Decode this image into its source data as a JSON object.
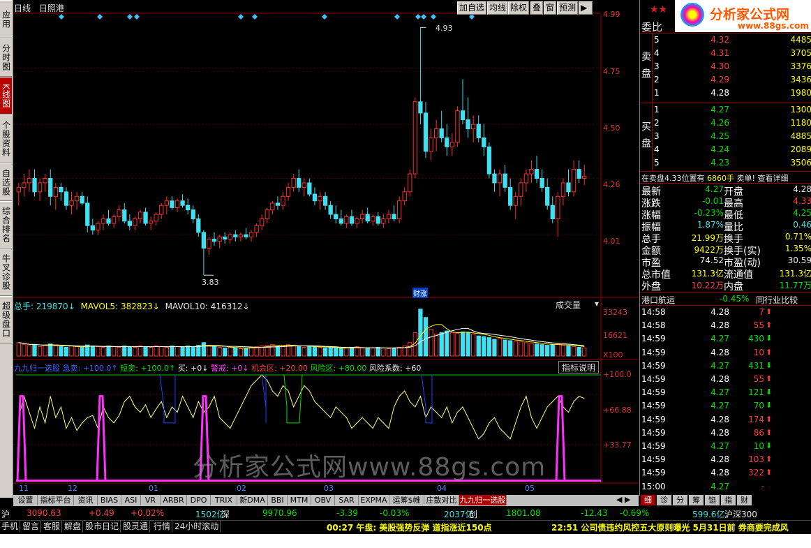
{
  "left_nav": [
    "应用",
    "分时图",
    "K线图",
    "个股资料",
    "自选股",
    "综合排名",
    "牛叉诊股",
    "超级盘口"
  ],
  "header": {
    "period": "日线",
    "stock": "日照港"
  },
  "toolbar": [
    "加自选",
    "均线",
    "除权",
    "叠",
    "窗",
    "预测"
  ],
  "price_axis": [
    "4.99",
    "4.75",
    "4.50",
    "4.26",
    "4.01"
  ],
  "annotations": {
    "high": "4.93",
    "low": "3.83",
    "event": "财涨"
  },
  "volume": {
    "label": "总手: 219870↓",
    "ma5": "MAVOL5: 382823↓",
    "ma10": "MAVOL10: 416312↓",
    "dropdown": "成交量",
    "axis": [
      "33243",
      "16621",
      "X100"
    ]
  },
  "indicator": {
    "legend": [
      "九九归一选股",
      "急卖: +100.0↑",
      "短卖: +100.0↑",
      "买: +0↓",
      "警戒: +0↓",
      "机会区: +20.00",
      "风险区: +80.00",
      "风险系数: +60"
    ],
    "button": "指标说明",
    "axis": [
      "+100.0",
      "+66.88",
      "+33.77"
    ]
  },
  "months": [
    "11",
    "12",
    "01",
    "02",
    "03",
    "04",
    "05"
  ],
  "watermark": "分析家公式网www.88gs.com",
  "tabs": [
    "设置",
    "指标平台",
    "资讯",
    "BIAS",
    "ASI",
    "VR",
    "ARBR",
    "DPO",
    "TRIX",
    "新DMA",
    "BBI",
    "MTM",
    "OBV",
    "SAR",
    "EXPMA",
    "运筹$帷幄",
    "庄散对比",
    "九九归一选股"
  ],
  "logo": {
    "title": "分析家公式网",
    "url": "www.88gs.com"
  },
  "order_book": {
    "header": "委比",
    "sell_label": "卖盘",
    "buy_label": "买盘",
    "sell": [
      {
        "lvl": "5",
        "price": "4.32",
        "vol": "4485"
      },
      {
        "lvl": "4",
        "price": "4.31",
        "vol": "3705"
      },
      {
        "lvl": "3",
        "price": "4.30",
        "vol": "3376"
      },
      {
        "lvl": "2",
        "price": "4.29",
        "vol": "3436"
      },
      {
        "lvl": "1",
        "price": "4.28",
        "vol": "1980"
      }
    ],
    "buy": [
      {
        "lvl": "1",
        "price": "4.27",
        "vol": "1300"
      },
      {
        "lvl": "2",
        "price": "4.26",
        "vol": "1180"
      },
      {
        "lvl": "3",
        "price": "4.25",
        "vol": "4885"
      },
      {
        "lvl": "4",
        "price": "4.24",
        "vol": "2089"
      },
      {
        "lvl": "5",
        "price": "4.23",
        "vol": "3506"
      }
    ],
    "notice_left": "在卖盘4.33位置有",
    "notice_vol": "6860手",
    "notice_right": "卖单! 查看详细"
  },
  "quote": [
    {
      "l": "最新",
      "v": "4.27",
      "c": "green",
      "l2": "开盘",
      "v2": "4.28",
      "c2": "white"
    },
    {
      "l": "涨跌",
      "v": "-0.01",
      "c": "green",
      "l2": "最高",
      "v2": "4.33",
      "c2": "red"
    },
    {
      "l": "涨幅",
      "v": "-0.23%",
      "c": "green",
      "l2": "最低",
      "v2": "4.25",
      "c2": "green"
    },
    {
      "l": "振幅",
      "v": "1.87%",
      "c": "cyan",
      "l2": "量比",
      "v2": "0.46",
      "c2": "cyan"
    },
    {
      "l": "总手",
      "v": "21.99万",
      "c": "yellow",
      "l2": "换手",
      "v2": "0.71%",
      "c2": "yellow"
    },
    {
      "l": "金额",
      "v": "9422万",
      "c": "yellow",
      "l2": "换手(实)",
      "v2": "1.35%",
      "c2": "yellow"
    },
    {
      "l": "市盈",
      "v": "74.52",
      "c": "white",
      "l2": "市盈(动)",
      "v2": "30.59",
      "c2": "white"
    },
    {
      "l": "总市值",
      "v": "131.3亿",
      "c": "yellow",
      "l2": "流通值",
      "v2": "131.3亿",
      "c2": "yellow"
    },
    {
      "l": "外盘",
      "v": "10.22万",
      "c": "red",
      "l2": "内盘",
      "v2": "11.77万",
      "c2": "green"
    }
  ],
  "sector": {
    "name": "港口航运",
    "pct": "-0.45%",
    "btn": "同行业比较"
  },
  "ticks": [
    {
      "t": "14:58",
      "p": "4.28",
      "v": "7",
      "d": "up"
    },
    {
      "t": "14:58",
      "p": "4.28",
      "v": "55",
      "d": "up"
    },
    {
      "t": "14:59",
      "p": "4.27",
      "v": "430",
      "d": "down"
    },
    {
      "t": "14:59",
      "p": "4.28",
      "v": "10",
      "d": "up"
    },
    {
      "t": "14:59",
      "p": "4.27",
      "v": "431",
      "d": "down"
    },
    {
      "t": "14:59",
      "p": "4.28",
      "v": "55",
      "d": "up"
    },
    {
      "t": "14:59",
      "p": "4.27",
      "v": "121",
      "d": "down"
    },
    {
      "t": "14:59",
      "p": "4.27",
      "v": "70",
      "d": "down"
    },
    {
      "t": "14:59",
      "p": "4.28",
      "v": "174",
      "d": "up"
    },
    {
      "t": "14:59",
      "p": "4.28",
      "v": "86",
      "d": "up"
    },
    {
      "t": "14:59",
      "p": "4.27",
      "v": "10",
      "d": "down"
    },
    {
      "t": "14:59",
      "p": "4.28",
      "v": "103",
      "d": "up"
    },
    {
      "t": "14:59",
      "p": "4.28",
      "v": "322",
      "d": "up"
    },
    {
      "t": "15:00",
      "p": "4.27",
      "v": "-",
      "d": "none"
    }
  ],
  "right_tabs": [
    "细",
    "诊",
    "分",
    "筹",
    "馅",
    "指",
    "财"
  ],
  "status": {
    "sh_label": "沪",
    "sh_idx": "3090.63",
    "sh_chg": "+0.49",
    "sh_pct": "+0.02%",
    "sh_amt": "1502亿",
    "sz_label": "深",
    "sz_idx": "9970.96",
    "sz_chg": "-3.39",
    "sz_pct": "-0.03%",
    "sz_amt": "2037亿",
    "cy_label": "创",
    "cy_idx": "1801.08",
    "cy_chg": "-12.43",
    "cy_pct": "-0.69%",
    "cy_amt": "599.6亿",
    "hs_label": "沪深300"
  },
  "bottom": {
    "buttons": [
      "手机",
      "留言",
      "客服",
      "解盘",
      "股市日记",
      "股灵通",
      "行情",
      "24小时滚动"
    ],
    "news1": "00:27 午盘: 美股强势反弹 道指涨近150点",
    "news2": "22:51 公司债违约风控五大原则曝光 5月31日前 券商要完成风"
  },
  "chart_data": {
    "type": "candlestick",
    "ylim": [
      3.75,
      4.99
    ],
    "candles": [
      [
        4.2,
        4.24,
        4.14,
        4.22
      ],
      [
        4.22,
        4.28,
        4.18,
        4.24
      ],
      [
        4.24,
        4.3,
        4.2,
        4.26
      ],
      [
        4.26,
        4.3,
        4.18,
        4.2
      ],
      [
        4.2,
        4.26,
        4.16,
        4.24
      ],
      [
        4.24,
        4.28,
        4.2,
        4.26
      ],
      [
        4.26,
        4.3,
        4.14,
        4.18
      ],
      [
        4.18,
        4.24,
        4.12,
        4.22
      ],
      [
        4.22,
        4.24,
        4.16,
        4.2
      ],
      [
        4.2,
        4.22,
        4.12,
        4.14
      ],
      [
        4.14,
        4.2,
        4.1,
        4.16
      ],
      [
        4.16,
        4.2,
        4.12,
        4.18
      ],
      [
        4.18,
        4.2,
        4.14,
        4.15
      ],
      [
        4.15,
        4.18,
        4.02,
        4.05
      ],
      [
        4.05,
        4.08,
        4.01,
        4.03
      ],
      [
        4.03,
        4.07,
        4.01,
        4.06
      ],
      [
        4.06,
        4.1,
        4.03,
        4.08
      ],
      [
        4.08,
        4.12,
        4.05,
        4.06
      ],
      [
        4.06,
        4.1,
        4.04,
        4.09
      ],
      [
        4.09,
        4.14,
        4.07,
        4.12
      ],
      [
        4.12,
        4.15,
        4.06,
        4.07
      ],
      [
        4.07,
        4.1,
        4.03,
        4.05
      ],
      [
        4.05,
        4.09,
        4.03,
        4.08
      ],
      [
        4.08,
        4.12,
        4.06,
        4.11
      ],
      [
        4.11,
        4.13,
        4.05,
        4.06
      ],
      [
        4.06,
        4.09,
        4.03,
        4.07
      ],
      [
        4.07,
        4.11,
        4.05,
        4.1
      ],
      [
        4.1,
        4.15,
        4.08,
        4.14
      ],
      [
        4.14,
        4.18,
        4.1,
        4.16
      ],
      [
        4.16,
        4.18,
        4.12,
        4.13
      ],
      [
        4.13,
        4.17,
        4.11,
        4.16
      ],
      [
        4.16,
        4.19,
        4.13,
        4.14
      ],
      [
        4.14,
        4.17,
        4.1,
        4.12
      ],
      [
        4.12,
        4.14,
        4.06,
        4.08
      ],
      [
        4.08,
        4.1,
        4.0,
        4.02
      ],
      [
        4.02,
        4.03,
        3.83,
        3.95
      ],
      [
        3.95,
        4.0,
        3.92,
        3.99
      ],
      [
        3.99,
        4.02,
        3.96,
        3.98
      ],
      [
        3.98,
        4.01,
        3.95,
        4.0
      ],
      [
        4.0,
        4.02,
        3.97,
        3.99
      ],
      [
        3.99,
        4.02,
        3.97,
        4.01
      ],
      [
        4.01,
        4.03,
        3.98,
        4.0
      ],
      [
        4.0,
        4.02,
        3.98,
        4.01
      ],
      [
        4.01,
        4.04,
        3.99,
        4.0
      ],
      [
        4.0,
        4.03,
        3.98,
        4.02
      ],
      [
        4.02,
        4.06,
        4.0,
        4.05
      ],
      [
        4.05,
        4.1,
        4.03,
        4.08
      ],
      [
        4.08,
        4.13,
        4.06,
        4.12
      ],
      [
        4.12,
        4.16,
        4.1,
        4.15
      ],
      [
        4.15,
        4.18,
        4.12,
        4.14
      ],
      [
        4.14,
        4.2,
        4.12,
        4.18
      ],
      [
        4.18,
        4.24,
        4.16,
        4.22
      ],
      [
        4.22,
        4.28,
        4.2,
        4.26
      ],
      [
        4.26,
        4.3,
        4.2,
        4.22
      ],
      [
        4.22,
        4.26,
        4.18,
        4.24
      ],
      [
        4.24,
        4.26,
        4.18,
        4.19
      ],
      [
        4.19,
        4.22,
        4.14,
        4.16
      ],
      [
        4.16,
        4.2,
        4.12,
        4.18
      ],
      [
        4.18,
        4.2,
        4.12,
        4.14
      ],
      [
        4.14,
        4.16,
        4.08,
        4.1
      ],
      [
        4.1,
        4.14,
        4.06,
        4.08
      ],
      [
        4.08,
        4.12,
        4.05,
        4.06
      ],
      [
        4.06,
        4.1,
        4.04,
        4.09
      ],
      [
        4.09,
        4.12,
        4.05,
        4.06
      ],
      [
        4.06,
        4.09,
        4.04,
        4.08
      ],
      [
        4.08,
        4.12,
        4.06,
        4.1
      ],
      [
        4.1,
        4.13,
        4.06,
        4.07
      ],
      [
        4.07,
        4.1,
        4.05,
        4.09
      ],
      [
        4.09,
        4.11,
        4.05,
        4.06
      ],
      [
        4.06,
        4.1,
        4.04,
        4.08
      ],
      [
        4.08,
        4.12,
        4.06,
        4.1
      ],
      [
        4.1,
        4.14,
        4.07,
        4.08
      ],
      [
        4.08,
        4.18,
        4.06,
        4.16
      ],
      [
        4.16,
        4.22,
        4.14,
        4.2
      ],
      [
        4.2,
        4.3,
        4.18,
        4.28
      ],
      [
        4.28,
        4.62,
        4.26,
        4.6
      ],
      [
        4.6,
        4.93,
        4.5,
        4.55
      ],
      [
        4.55,
        4.6,
        4.35,
        4.38
      ],
      [
        4.38,
        4.48,
        4.34,
        4.44
      ],
      [
        4.44,
        4.52,
        4.38,
        4.48
      ],
      [
        4.48,
        4.56,
        4.42,
        4.44
      ],
      [
        4.44,
        4.5,
        4.36,
        4.4
      ],
      [
        4.4,
        4.46,
        4.36,
        4.42
      ],
      [
        4.42,
        4.58,
        4.4,
        4.56
      ],
      [
        4.56,
        4.7,
        4.5,
        4.52
      ],
      [
        4.52,
        4.62,
        4.44,
        4.48
      ],
      [
        4.48,
        4.54,
        4.42,
        4.5
      ],
      [
        4.5,
        4.54,
        4.42,
        4.44
      ],
      [
        4.44,
        4.5,
        4.36,
        4.4
      ],
      [
        4.4,
        4.42,
        4.26,
        4.28
      ],
      [
        4.28,
        4.3,
        4.2,
        4.24
      ],
      [
        4.24,
        4.3,
        4.18,
        4.28
      ],
      [
        4.28,
        4.32,
        4.2,
        4.22
      ],
      [
        4.22,
        4.26,
        4.12,
        4.14
      ],
      [
        4.14,
        4.2,
        4.08,
        4.18
      ],
      [
        4.18,
        4.26,
        4.14,
        4.24
      ],
      [
        4.24,
        4.3,
        4.2,
        4.28
      ],
      [
        4.28,
        4.34,
        4.24,
        4.3
      ],
      [
        4.3,
        4.36,
        4.24,
        4.26
      ],
      [
        4.26,
        4.3,
        4.2,
        4.22
      ],
      [
        4.22,
        4.26,
        4.12,
        4.14
      ],
      [
        4.14,
        4.18,
        4.06,
        4.08
      ],
      [
        4.08,
        4.2,
        4.0,
        4.18
      ],
      [
        4.18,
        4.26,
        4.14,
        4.24
      ],
      [
        4.24,
        4.3,
        4.18,
        4.2
      ],
      [
        4.2,
        4.34,
        4.18,
        4.3
      ],
      [
        4.3,
        4.34,
        4.24,
        4.26
      ],
      [
        4.26,
        4.32,
        4.23,
        4.27
      ]
    ],
    "volume": [
      40,
      35,
      30,
      34,
      28,
      32,
      36,
      30,
      28,
      26,
      30,
      28,
      26,
      33,
      30,
      28,
      26,
      30,
      28,
      26,
      30,
      28,
      26,
      30,
      28,
      26,
      30,
      28,
      26,
      30,
      28,
      26,
      30,
      28,
      32,
      40,
      30,
      28,
      26,
      24,
      26,
      24,
      22,
      24,
      26,
      28,
      30,
      32,
      34,
      30,
      32,
      34,
      30,
      28,
      26,
      30,
      28,
      26,
      24,
      26,
      24,
      22,
      24,
      26,
      28,
      24,
      22,
      24,
      26,
      24,
      22,
      24,
      26,
      30,
      40,
      70,
      140,
      115,
      80,
      65,
      70,
      75,
      70,
      68,
      72,
      70,
      65,
      60,
      58,
      55,
      50,
      52,
      48,
      46,
      44,
      42,
      40,
      38,
      36,
      34,
      32,
      34,
      36,
      32,
      30,
      28,
      26,
      24
    ],
    "signal_days": [
      5,
      9,
      19,
      21,
      35,
      37,
      81,
      83,
      96,
      98
    ],
    "line": [
      60,
      80,
      65,
      50,
      70,
      55,
      80,
      60,
      70,
      50,
      60,
      48,
      55,
      60,
      62,
      50,
      70,
      60,
      55,
      62,
      75,
      80,
      70,
      65,
      72,
      60,
      68,
      75,
      60,
      70,
      65,
      80,
      70,
      60,
      75,
      65,
      70,
      80,
      60,
      55,
      50,
      60,
      70,
      80,
      90,
      95,
      100,
      95,
      85,
      80,
      90,
      85,
      70,
      80,
      90,
      85,
      75,
      70,
      65,
      60,
      70,
      65,
      60,
      50,
      55,
      60,
      55,
      50,
      60,
      55,
      50,
      70,
      80,
      85,
      75,
      70,
      80,
      60,
      70,
      65,
      60,
      70,
      55,
      65,
      70,
      60,
      50,
      40,
      45,
      55,
      60,
      50,
      45,
      40,
      55,
      70,
      80,
      60,
      50,
      60,
      70,
      75,
      80,
      70,
      65,
      75,
      80,
      78
    ]
  }
}
